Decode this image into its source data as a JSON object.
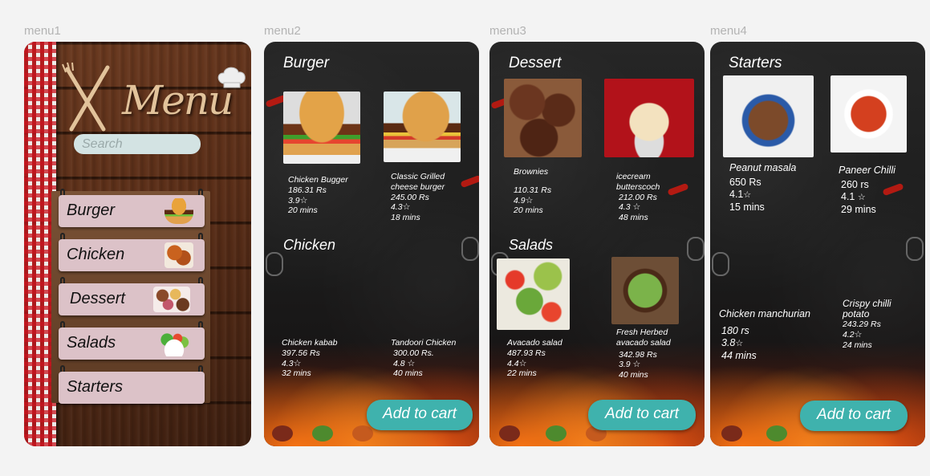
{
  "frames": {
    "menu1": "menu1",
    "menu2": "menu2",
    "menu3": "menu3",
    "menu4": "menu4"
  },
  "menu1": {
    "logo_text": "Menu",
    "search_placeholder": "Search",
    "categories": [
      "Burger",
      "Chicken",
      "Dessert",
      "Salads",
      "Starters"
    ]
  },
  "menu2": {
    "sections": [
      {
        "title": "Burger",
        "items": [
          {
            "name": "Chicken Bugger",
            "price": "186.31 Rs",
            "rating": "3.9",
            "time": "20 mins"
          },
          {
            "name": "Classic Grilled cheese burger",
            "price": "245.00 Rs",
            "rating": "4.3",
            "time": "18 mins"
          }
        ]
      },
      {
        "title": "Chicken",
        "items": [
          {
            "name": "Chicken kabab",
            "price": "397.56 Rs",
            "rating": "4.3",
            "time": "32 mins"
          },
          {
            "name": "Tandoori Chicken",
            "price": "300.00 Rs.",
            "rating": "4.8",
            "time": "40 mins"
          }
        ]
      }
    ],
    "cart": "Add to cart"
  },
  "menu3": {
    "sections": [
      {
        "title": "Dessert",
        "items": [
          {
            "name": "Brownies",
            "price": "110.31 Rs",
            "rating": "4.9",
            "time": "20 mins"
          },
          {
            "name": "icecream butterscoch",
            "price": "212.00 Rs",
            "rating": "4.3",
            "time": "48 mins"
          }
        ]
      },
      {
        "title": "Salads",
        "items": [
          {
            "name": "Avacado salad",
            "price": "487.93 Rs",
            "rating": "4.4",
            "time": "22 mins"
          },
          {
            "name": "Fresh Herbed avacado salad",
            "price": "342.98 Rs",
            "rating": "3.9",
            "time": "40 mins"
          }
        ]
      }
    ],
    "cart": "Add to cart"
  },
  "menu4": {
    "sections": [
      {
        "title": "Starters",
        "items": [
          {
            "name": "Peanut masala",
            "price": "650 Rs",
            "rating": "4.1",
            "time": "15 mins"
          },
          {
            "name": "Paneer Chilli",
            "price": "260 rs",
            "rating": "4.1",
            "time": "29 mins"
          },
          {
            "name": "Chicken manchurian",
            "price": "180 rs",
            "rating": "3.8",
            "time": "44 mins"
          },
          {
            "name": "Crispy chilli potato",
            "price": "243.29 Rs",
            "rating": "4.2",
            "time": "24 mins"
          }
        ]
      }
    ],
    "cart": "Add to cart"
  },
  "icons": {
    "rating": "star-outline-icon",
    "logo": "fork-knife-chef-hat-icon"
  },
  "colors": {
    "cart_button": "#3fb2ad",
    "category_button": "#dcc2c8",
    "search_bg": "#d3e3e3"
  }
}
